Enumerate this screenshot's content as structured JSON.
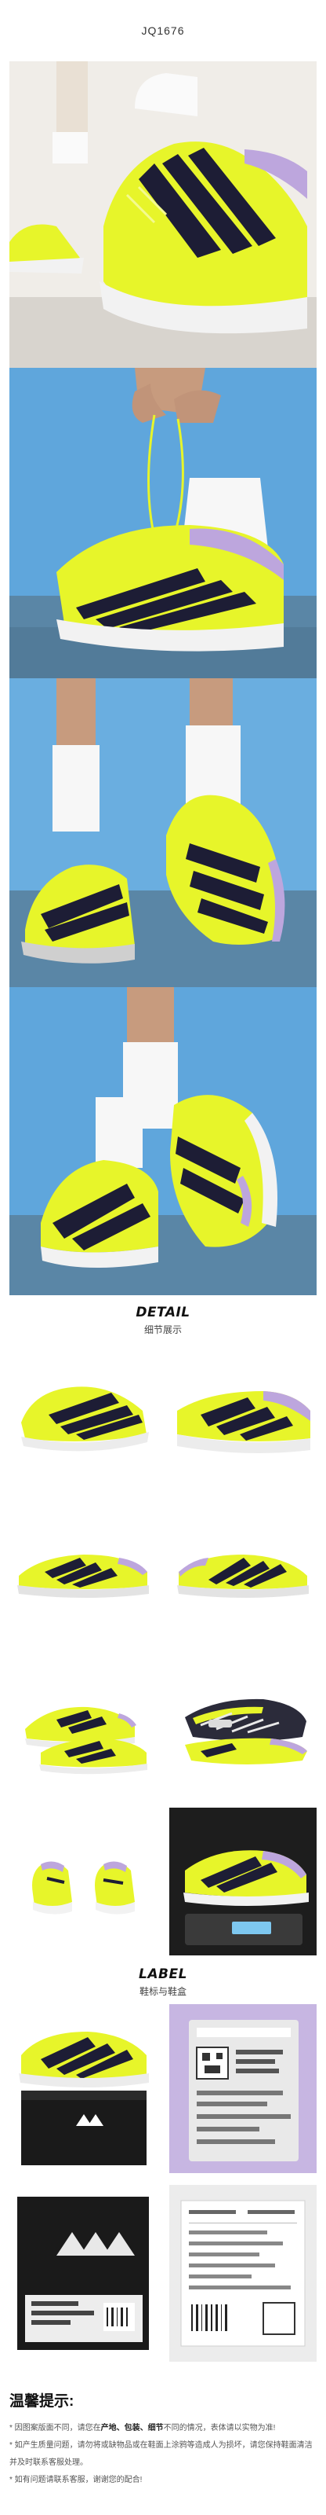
{
  "product": {
    "code": "JQ1676"
  },
  "sections": {
    "detail": {
      "title": "DETAIL",
      "subtitle": "细节展示"
    },
    "label": {
      "title": "LABEL",
      "subtitle": "鞋标与鞋盒"
    }
  },
  "notice": {
    "title": "温馨提示:",
    "lines": [
      {
        "pre": "* 因图案版面不同，请您在",
        "bold": "产地、包装、细节",
        "post": "不同的情况，表体请以实物为准!"
      },
      {
        "pre": "* 如产生质量问题，请勿将或缺物品或在鞋面上涂鸦等造成人为损坏，",
        "bold": "",
        "post": "请您保持鞋面清洁并及时联系客服处理。"
      },
      {
        "pre": "* 如有问题请联系客服，谢谢您的配合!",
        "bold": "",
        "post": ""
      }
    ]
  },
  "colors": {
    "shoe": "#e7f52a",
    "stripe": "#1d1d35",
    "sole": "#f2f2f2",
    "lilac": "#bda6dd",
    "court": "#5a86a6",
    "sky": "#5fa6dc"
  }
}
